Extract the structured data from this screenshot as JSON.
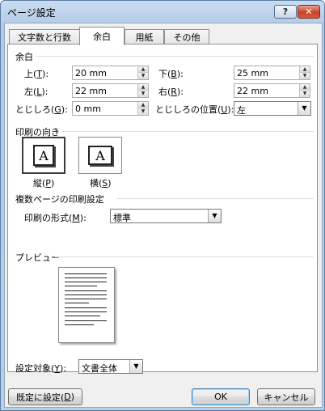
{
  "window": {
    "title": "ページ設定",
    "help_label": "?",
    "close_label": "✕"
  },
  "tabs": [
    {
      "label": "文字数と行数",
      "active": false
    },
    {
      "label": "余白",
      "active": true
    },
    {
      "label": "用紙",
      "active": false
    },
    {
      "label": "その他",
      "active": false
    }
  ],
  "margins": {
    "group_label": "余白",
    "top": {
      "label_pre": "上(",
      "key": "T",
      "label_post": "):",
      "value": "20 mm"
    },
    "bottom": {
      "label_pre": "下(",
      "key": "B",
      "label_post": "):",
      "value": "25 mm"
    },
    "left": {
      "label_pre": "左(",
      "key": "L",
      "label_post": "):",
      "value": "22 mm"
    },
    "right": {
      "label_pre": "右(",
      "key": "R",
      "label_post": "):",
      "value": "22 mm"
    },
    "gutter": {
      "label_pre": "とじしろ(",
      "key": "G",
      "label_post": "):",
      "value": "0 mm"
    },
    "gutter_pos": {
      "label_pre": "とじしろの位置(",
      "key": "U",
      "label_post": "):",
      "value": "左"
    }
  },
  "orientation": {
    "group_label": "印刷の向き",
    "portrait": {
      "icon_text": "A",
      "label_pre": "縦(",
      "key": "P",
      "label_post": ")"
    },
    "landscape": {
      "icon_text": "A",
      "label_pre": "横(",
      "key": "S",
      "label_post": ")"
    }
  },
  "multipage": {
    "group_label": "複数ページの印刷設定",
    "label_pre": "印刷の形式(",
    "key": "M",
    "label_post": "):",
    "value": "標準"
  },
  "preview": {
    "group_label": "プレビュー"
  },
  "apply_to": {
    "label_pre": "設定対象(",
    "key": "Y",
    "label_post": "):",
    "value": "文書全体"
  },
  "buttons": {
    "default_pre": "既定に設定(",
    "default_key": "D",
    "default_post": ")",
    "ok": "OK",
    "cancel": "キャンセル"
  }
}
